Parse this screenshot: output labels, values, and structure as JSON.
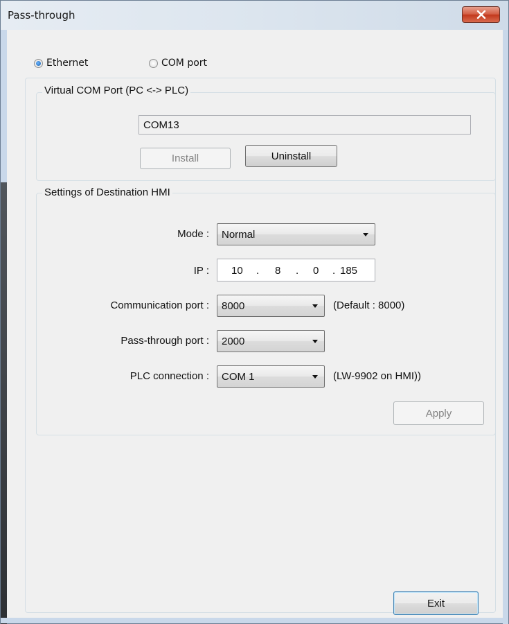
{
  "window": {
    "title": "Pass-through",
    "close_icon": "close-x-icon"
  },
  "connection": {
    "ethernet_label": "Ethernet",
    "com_port_label": "COM port",
    "selected": "Ethernet"
  },
  "virtual_com": {
    "group_title": "Virtual COM Port (PC <-> PLC)",
    "port_value": "COM13",
    "install_label": "Install",
    "uninstall_label": "Uninstall"
  },
  "destination": {
    "group_title": "Settings of Destination HMI",
    "mode_label": "Mode :",
    "mode_value": "Normal",
    "ip_label": "IP :",
    "ip_octets": [
      "10",
      "8",
      "0",
      "185"
    ],
    "ip_dot": ".",
    "comm_port_label": "Communication port :",
    "comm_port_value": "8000",
    "comm_port_hint": "(Default : 8000)",
    "pt_port_label": "Pass-through port :",
    "pt_port_value": "2000",
    "plc_label": "PLC connection :",
    "plc_value": "COM 1",
    "plc_hint": "(LW-9902 on HMI))",
    "apply_label": "Apply"
  },
  "footer": {
    "exit_label": "Exit"
  },
  "colors": {
    "title_bg": "#dde6ef",
    "close_red": "#c2381c",
    "client_bg": "#f0f0f0",
    "default_button_border": "#3c7fb1"
  }
}
